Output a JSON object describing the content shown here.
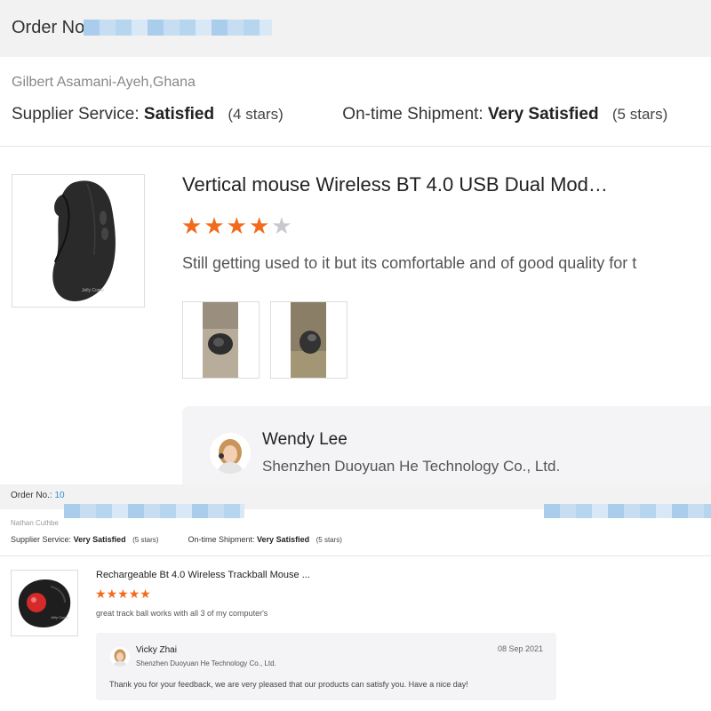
{
  "review_top": {
    "order_label": "Order No",
    "reviewer": "Gilbert Asamani-Ayeh,Ghana",
    "supplier_service_label": "Supplier Service:",
    "supplier_service_value": "Satisfied",
    "supplier_service_stars": "(4 stars)",
    "shipment_label": "On-time Shipment:",
    "shipment_value": "Very Satisfied",
    "shipment_stars": "(5 stars)",
    "product_title": "Vertical mouse Wireless BT 4.0 USB Dual Mod…",
    "rating": 4,
    "rating_max": 5,
    "comment": "Still getting used to it but its comfortable and of good quality for t",
    "seller_name": "Wendy Lee",
    "seller_company": "Shenzhen Duoyuan He Technology Co., Ltd.",
    "product_image_caption": "Jelly Comb"
  },
  "review_bottom": {
    "order_label": "Order No.:",
    "order_number_visible": "10",
    "reviewer": "Nathan Cuthbe",
    "supplier_service_label": "Supplier Service:",
    "supplier_service_value": "Very Satisfied",
    "supplier_service_stars": "(5 stars)",
    "shipment_label": "On-time Shipment:",
    "shipment_value": "Very Satisfied",
    "shipment_stars": "(5 stars)",
    "product_title": "Rechargeable Bt 4.0 Wireless Trackball Mouse ...",
    "rating": 5,
    "rating_max": 5,
    "comment": "great track ball works with all 3 of my computer's",
    "seller_name": "Vicky Zhai",
    "seller_company": "Shenzhen Duoyuan He Technology Co., Ltd.",
    "reply_date": "08 Sep 2021",
    "reply_text": "Thank you for your feedback, we are very pleased that our products can satisfy you. Have a nice day!",
    "product_image_caption": "Jelly Comb"
  },
  "colors": {
    "star_on": "#f26b1d",
    "star_off": "#c8c8d0",
    "link_blue": "#2b8fd7",
    "header_bg": "#f2f2f2",
    "reply_bg": "#f4f4f6"
  },
  "icons": {
    "star": "star-icon",
    "avatar": "avatar-icon"
  }
}
